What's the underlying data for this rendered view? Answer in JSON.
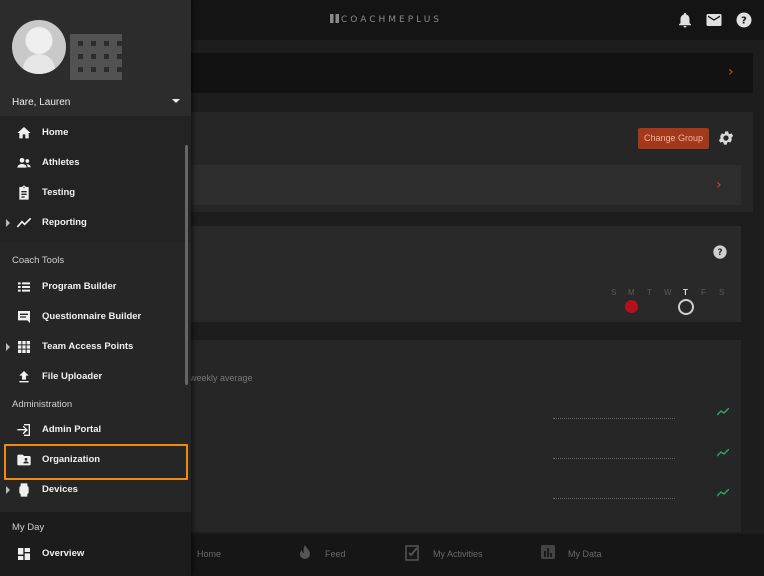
{
  "brand": {
    "name": "COACHMEPLUS"
  },
  "topbar": {
    "icons": [
      "bell-icon",
      "mail-icon",
      "help-icon"
    ]
  },
  "main": {
    "change_group_label": "Change Group",
    "weekdays": [
      "S",
      "M",
      "T",
      "W",
      "T",
      "F",
      "S"
    ],
    "current_day_index": 4,
    "weekly_label": "weekly average"
  },
  "bottom_nav": {
    "items": [
      {
        "label": "Home",
        "icon": "home-icon"
      },
      {
        "label": "Feed",
        "icon": "fire-icon"
      },
      {
        "label": "My Activities",
        "icon": "checklist-icon"
      },
      {
        "label": "My Data",
        "icon": "bar-chart-icon"
      }
    ]
  },
  "sidebar": {
    "user_name": "Hare, Lauren",
    "items": [
      {
        "label": "Home",
        "icon": "home-icon"
      },
      {
        "label": "Athletes",
        "icon": "people-icon"
      },
      {
        "label": "Testing",
        "icon": "clipboard-icon"
      },
      {
        "label": "Reporting",
        "icon": "trend-line-icon"
      }
    ],
    "coach_tools": {
      "title": "Coach Tools",
      "items": [
        {
          "label": "Program Builder",
          "icon": "list-icon"
        },
        {
          "label": "Questionnaire Builder",
          "icon": "message-icon"
        },
        {
          "label": "Team Access Points",
          "icon": "grid-icon"
        },
        {
          "label": "File Uploader",
          "icon": "upload-icon"
        }
      ]
    },
    "administration": {
      "title": "Administration",
      "items": [
        {
          "label": "Admin Portal",
          "icon": "login-icon"
        },
        {
          "label": "Organization",
          "icon": "folder-person-icon"
        },
        {
          "label": "Devices",
          "icon": "watch-icon"
        }
      ]
    },
    "my_day": {
      "title": "My Day",
      "items": [
        {
          "label": "Overview",
          "icon": "dashboard-icon"
        }
      ]
    }
  },
  "colors": {
    "accent": "#d9461c",
    "highlight": "#f28a10",
    "trend": "#2fa36a",
    "alert_red": "#b3121c"
  }
}
